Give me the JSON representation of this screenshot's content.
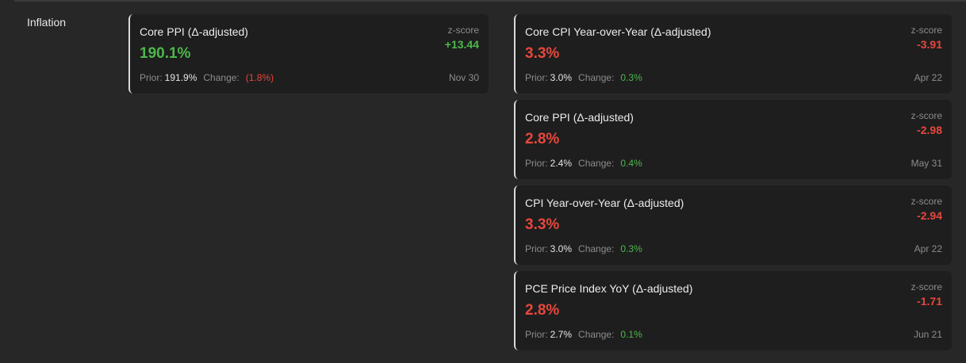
{
  "section": {
    "label": "Inflation"
  },
  "cards": [
    {
      "title": "Core PPI (Δ-adjusted)",
      "value": "190.1%",
      "zscore_label": "z-score",
      "zscore": "+13.44",
      "prior_label": "Prior:",
      "prior": "191.9%",
      "change_label": "Change:",
      "change": "(1.8%)",
      "date": "Nov 30",
      "value_color": "#4cb84a",
      "zscore_color": "#4cb84a",
      "change_color": "#e8473c"
    },
    {
      "title": "Core CPI Year-over-Year (Δ-adjusted)",
      "value": "3.3%",
      "zscore_label": "z-score",
      "zscore": "-3.91",
      "prior_label": "Prior:",
      "prior": "3.0%",
      "change_label": "Change:",
      "change": "0.3%",
      "date": "Apr 22",
      "value_color": "#e8473c",
      "zscore_color": "#e8473c",
      "change_color": "#4cb84a"
    },
    {
      "title": "Core PPI (Δ-adjusted)",
      "value": "2.8%",
      "zscore_label": "z-score",
      "zscore": "-2.98",
      "prior_label": "Prior:",
      "prior": "2.4%",
      "change_label": "Change:",
      "change": "0.4%",
      "date": "May 31",
      "value_color": "#e8473c",
      "zscore_color": "#e8473c",
      "change_color": "#4cb84a"
    },
    {
      "title": "CPI Year-over-Year (Δ-adjusted)",
      "value": "3.3%",
      "zscore_label": "z-score",
      "zscore": "-2.94",
      "prior_label": "Prior:",
      "prior": "3.0%",
      "change_label": "Change:",
      "change": "0.3%",
      "date": "Apr 22",
      "value_color": "#e8473c",
      "zscore_color": "#e8473c",
      "change_color": "#4cb84a"
    },
    {
      "title": "PCE Price Index YoY (Δ-adjusted)",
      "value": "2.8%",
      "zscore_label": "z-score",
      "zscore": "-1.71",
      "prior_label": "Prior:",
      "prior": "2.7%",
      "change_label": "Change:",
      "change": "0.1%",
      "date": "Jun 21",
      "value_color": "#e8473c",
      "zscore_color": "#e8473c",
      "change_color": "#4cb84a"
    }
  ]
}
